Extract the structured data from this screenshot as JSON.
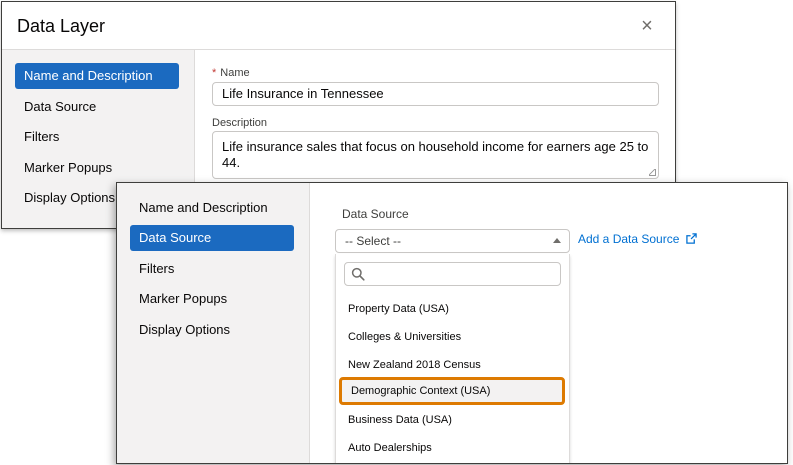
{
  "back_dialog": {
    "title": "Data Layer",
    "close_glyph": "×",
    "nav": [
      {
        "label": "Name and Description",
        "active": true
      },
      {
        "label": "Data Source",
        "active": false
      },
      {
        "label": "Filters",
        "active": false
      },
      {
        "label": "Marker Popups",
        "active": false
      },
      {
        "label": "Display Options",
        "active": false
      }
    ],
    "name_field": {
      "required_mark": "*",
      "label": "Name",
      "value": "Life Insurance in Tennessee"
    },
    "description_field": {
      "label": "Description",
      "value": "Life insurance sales that focus on household income for earners age 25 to 44."
    }
  },
  "front_dialog": {
    "nav": [
      {
        "label": "Name and Description",
        "active": false
      },
      {
        "label": "Data Source",
        "active": true
      },
      {
        "label": "Filters",
        "active": false
      },
      {
        "label": "Marker Popups",
        "active": false
      },
      {
        "label": "Display Options",
        "active": false
      }
    ],
    "data_source_label": "Data Source",
    "select_value": "-- Select --",
    "add_link_label": "Add a Data Source",
    "search_placeholder": "",
    "options": [
      {
        "label": "Property Data (USA)",
        "highlighted": false
      },
      {
        "label": "Colleges & Universities",
        "highlighted": false
      },
      {
        "label": "New Zealand 2018 Census",
        "highlighted": false
      },
      {
        "label": "Demographic Context (USA)",
        "highlighted": true
      },
      {
        "label": "Business Data (USA)",
        "highlighted": false
      },
      {
        "label": "Auto Dealerships",
        "highlighted": false
      }
    ]
  },
  "colors": {
    "active_nav": "#1b6ac0",
    "link": "#0070d2",
    "highlight_border": "#dd7a01",
    "required": "#c23934"
  },
  "icons": {
    "close": "close-icon",
    "search": "search-icon",
    "external_link": "external-link-icon",
    "select_caret": "caret-up-icon"
  }
}
